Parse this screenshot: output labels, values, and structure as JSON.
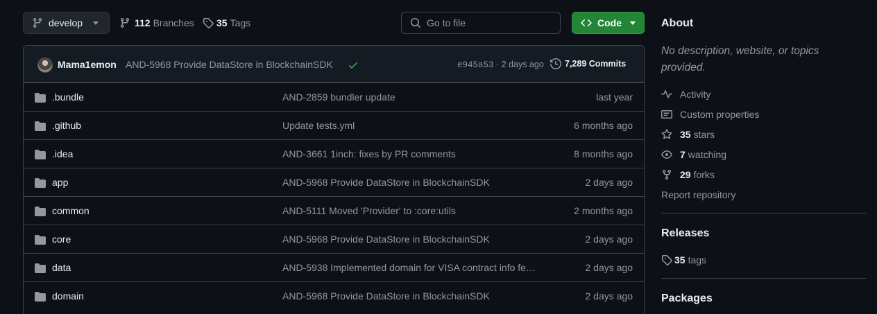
{
  "toolbar": {
    "branch": "develop",
    "branches_count": "112",
    "branches_label": "Branches",
    "tags_count": "35",
    "tags_label": "Tags",
    "search_placeholder": "Go to file",
    "code_label": "Code"
  },
  "commit": {
    "author": "Mama1emon",
    "message": "AND-5968 Provide DataStore in BlockchainSDK",
    "sha": "e945a53",
    "sha_sep": " · ",
    "ago": "2 days ago",
    "commits_count": "7,289 Commits",
    "status_color": "#3fb950"
  },
  "files": [
    {
      "name": ".bundle",
      "message": "AND-2859 bundler update",
      "time": "last year"
    },
    {
      "name": ".github",
      "message": "Update tests.yml",
      "time": "6 months ago"
    },
    {
      "name": ".idea",
      "message": "AND-3661 1inch: fixes by PR comments",
      "time": "8 months ago"
    },
    {
      "name": "app",
      "message": "AND-5968 Provide DataStore in BlockchainSDK",
      "time": "2 days ago"
    },
    {
      "name": "common",
      "message": "AND-5111 Moved 'Provider' to :core:utils",
      "time": "2 months ago"
    },
    {
      "name": "core",
      "message": "AND-5968 Provide DataStore in BlockchainSDK",
      "time": "2 days ago"
    },
    {
      "name": "data",
      "message": "AND-5938 Implemented domain for VISA contract info fe…",
      "time": "2 days ago"
    },
    {
      "name": "domain",
      "message": "AND-5968 Provide DataStore in BlockchainSDK",
      "time": "2 days ago"
    }
  ],
  "about": {
    "heading": "About",
    "description": "No description, website, or topics provided.",
    "activity": "Activity",
    "custom_properties": "Custom properties",
    "stars_count": "35",
    "stars_label": "stars",
    "watching_count": "7",
    "watching_label": "watching",
    "forks_count": "29",
    "forks_label": "forks",
    "report": "Report repository"
  },
  "releases": {
    "heading": "Releases",
    "tags_count": "35",
    "tags_label": "tags"
  },
  "packages": {
    "heading": "Packages"
  },
  "colors": {
    "background": "#0d1117",
    "border": "#3d444d",
    "code_button": "#238636",
    "folder_icon": "#9198a1"
  }
}
